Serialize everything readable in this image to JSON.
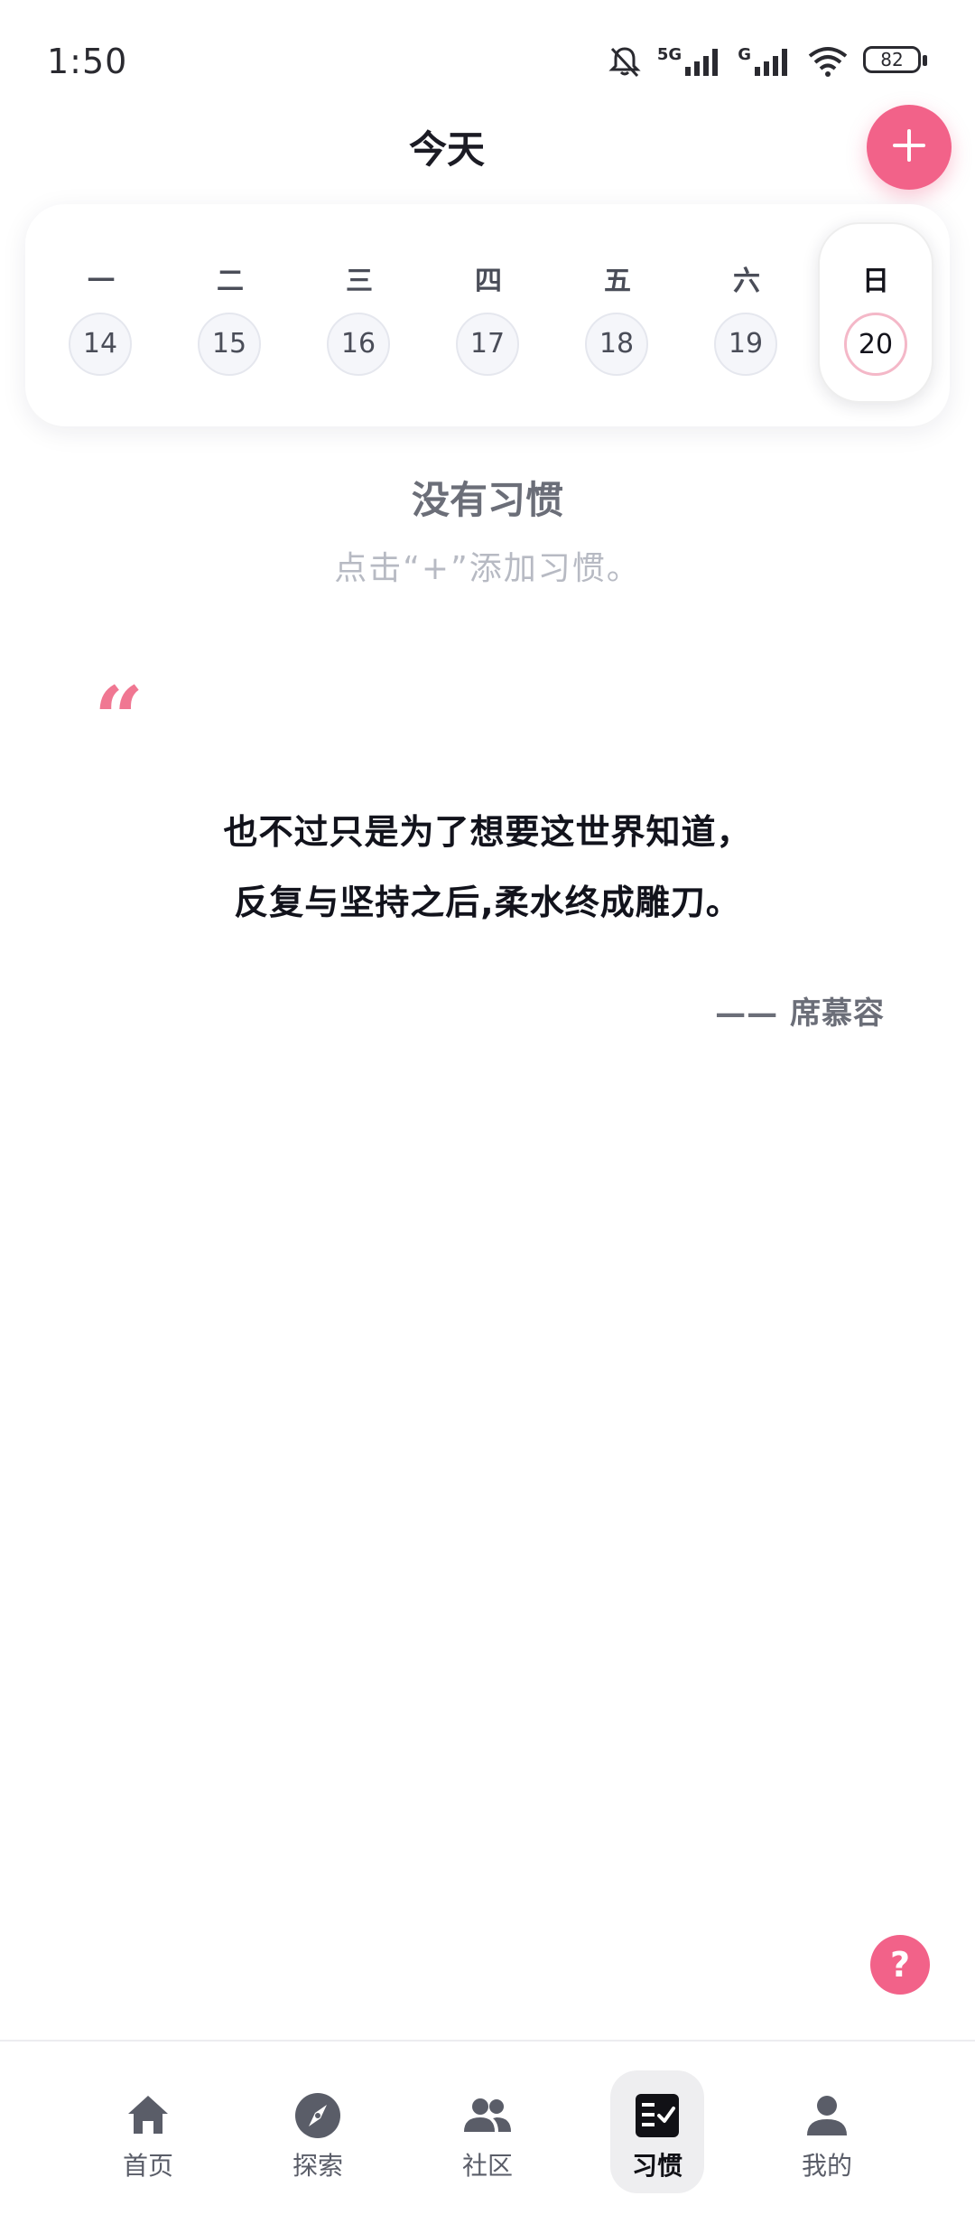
{
  "status_bar": {
    "time": "1:50",
    "network_label": "5G",
    "network_label_2": "G",
    "battery": "82"
  },
  "header": {
    "title": "今天",
    "add_icon": "plus-icon"
  },
  "week": {
    "days": [
      {
        "label": "一",
        "date": "14",
        "selected": false
      },
      {
        "label": "二",
        "date": "15",
        "selected": false
      },
      {
        "label": "三",
        "date": "16",
        "selected": false
      },
      {
        "label": "四",
        "date": "17",
        "selected": false
      },
      {
        "label": "五",
        "date": "18",
        "selected": false
      },
      {
        "label": "六",
        "date": "19",
        "selected": false
      },
      {
        "label": "日",
        "date": "20",
        "selected": true
      }
    ]
  },
  "empty_state": {
    "title": "没有习惯",
    "hint": "点击“+”添加习惯。"
  },
  "quote": {
    "mark": "“",
    "line1": "也不过只是为了想要这世界知道，",
    "line2": "反复与坚持之后,柔水终成雕刀。",
    "author": "—— 席慕容"
  },
  "help": {
    "label": "?"
  },
  "bottom_nav": {
    "items": [
      {
        "label": "首页",
        "icon": "home-icon",
        "active": false
      },
      {
        "label": "探索",
        "icon": "compass-icon",
        "active": false
      },
      {
        "label": "社区",
        "icon": "people-icon",
        "active": false
      },
      {
        "label": "习惯",
        "icon": "checklist-icon",
        "active": true
      },
      {
        "label": "我的",
        "icon": "person-icon",
        "active": false
      }
    ]
  },
  "colors": {
    "accent": "#f26289",
    "text_primary": "#12131c",
    "text_muted": "#6b6e78",
    "text_hint": "#b7bac3"
  }
}
